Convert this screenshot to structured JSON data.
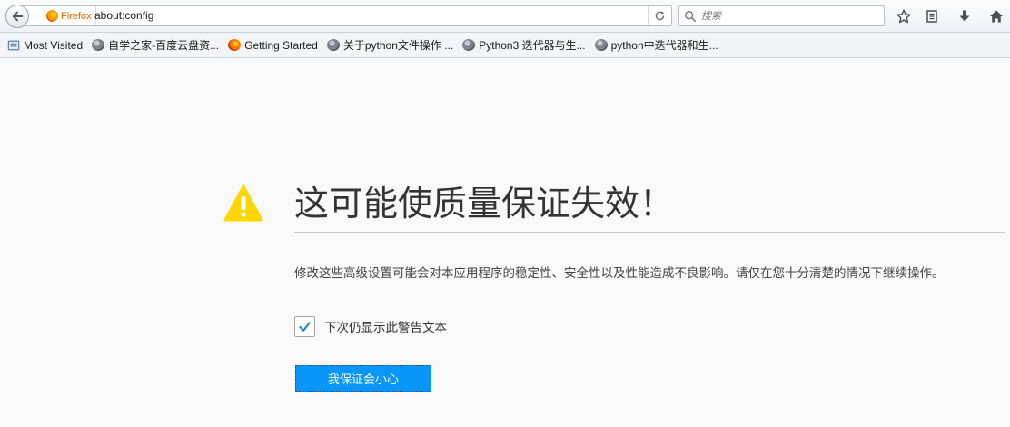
{
  "toolbar": {
    "identity_label": "Firefox",
    "url": "about:config",
    "search_placeholder": "搜索"
  },
  "bookmarks": [
    {
      "label": "Most Visited",
      "icon": "bookmarks-folder-icon"
    },
    {
      "label": "自学之家-百度云盘资...",
      "icon": "globe-icon"
    },
    {
      "label": "Getting Started",
      "icon": "firefox-icon"
    },
    {
      "label": "关于python文件操作 ...",
      "icon": "globe-icon"
    },
    {
      "label": "Python3 迭代器与生...",
      "icon": "globe-icon"
    },
    {
      "label": "python中迭代器和生...",
      "icon": "globe-icon"
    }
  ],
  "warning": {
    "title": "这可能使质量保证失效！",
    "description": "修改这些高级设置可能会对本应用程序的稳定性、安全性以及性能造成不良影响。请仅在您十分清楚的情况下继续操作。",
    "checkbox_label": "下次仍显示此警告文本",
    "checkbox_checked": true,
    "button_label": "我保证会小心"
  },
  "colors": {
    "accent": "#0996f8",
    "warning": "#ffd700",
    "firefox_orange": "#e66000"
  }
}
